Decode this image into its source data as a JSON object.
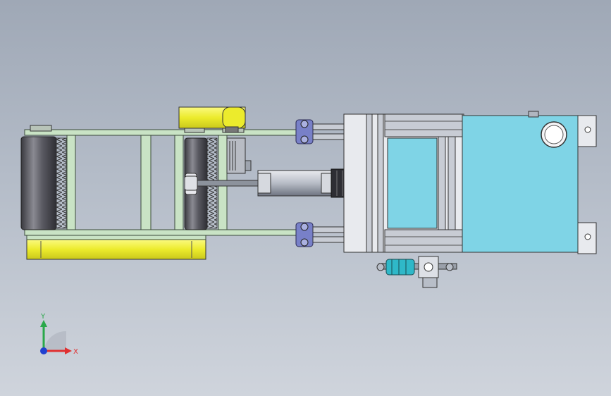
{
  "viewport": {
    "background_top": "#9fa8b6",
    "background_bottom": "#cfd4dc"
  },
  "triad": {
    "y_label": "Y",
    "x_label": "X",
    "y_color": "#2aa84a",
    "x_color": "#e03030",
    "z_color": "#2040d0"
  },
  "colors": {
    "frame_green": "#c9e3c5",
    "frame_edge": "#3a4a3a",
    "yellow_part": "#f0ee3c",
    "cyan_plate": "#7fd4e6",
    "roller_dark": "#55555c",
    "link_purple": "#7880c8",
    "profile_grey": "#c8ccd4"
  }
}
